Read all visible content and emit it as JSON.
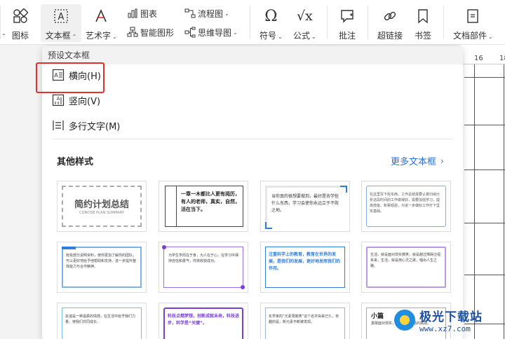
{
  "ribbon": {
    "partial_button": "图标",
    "textbox": "文本框",
    "wordart": "艺术字",
    "chart": "图表",
    "smartart": "智能图形",
    "flowchart": "流程图",
    "mindmap": "思维导图",
    "symbol": "符号",
    "formula": "公式",
    "comment": "批注",
    "hyperlink": "超链接",
    "bookmark": "书签",
    "docparts": "文档部件"
  },
  "ruler": {
    "marks": [
      "16",
      "18"
    ]
  },
  "dropdown": {
    "header": "预设文本框",
    "items": [
      {
        "label": "横向(H)"
      },
      {
        "label": "竖向(V)"
      },
      {
        "label": "多行文字(M)"
      }
    ],
    "other_styles_title": "其他样式",
    "more_link": "更多文本框"
  },
  "thumbnails": {
    "t1_title": "简约计划总结",
    "t1_sub": "CONCISE PLAN SUMMARY",
    "t2_text": "一章一木都比人更有阅历，有人的老师，真实，自然，活在当下。",
    "t3_text": "当你真的很想要做到，最好是去学些什么东西，学习会使你永远立于不败之地。",
    "t4_text": "在这里写下些东西，工作总结需要认真归纳分析这段时间的工作做得好，需要加强学习，提高技能，积累经验，为进一步做好工作打下坚实基础。",
    "t5_text": "有些部分说明资料，使你更加了解你的团队，可以更好地给予他帮助和支持。进一步提升整体能力与合作精神。",
    "t6_text": "为学生学而在于身，为人在于心，在学习中保持自信和勇气，你将收获成功。",
    "t7_text": "注重科学上的教育，教育在世界的发展，是我们的发展，更好地发挥我们的作用。",
    "t8_text": "生活，就是面对现实微笑，就是越过障碍注视未来，生活，就是用心灵之歌，唱出人生之路。",
    "t9_text": "友谊是一种温柔的情感，在生活中给予我们力量，使我们共同成长。",
    "t10_text": "科技点燃梦想，创新成就未来，科技进步，科学是“关键”。",
    "t11_text": "化学家的“元素周期表”这个名字由来已久，有趣的是，新元素不断被发现。",
    "t12_title": "小篇",
    "t12_text": "勇敢面对现实，勇敢面对生活的挑战。"
  },
  "watermark": {
    "name": "极光下载站",
    "url": "www.xz7.com"
  },
  "colors": {
    "highlight": "#e0312a",
    "link": "#2a6fd6",
    "accent_blue": "#2f7fd8",
    "accent_purple": "#7a3fd0"
  }
}
